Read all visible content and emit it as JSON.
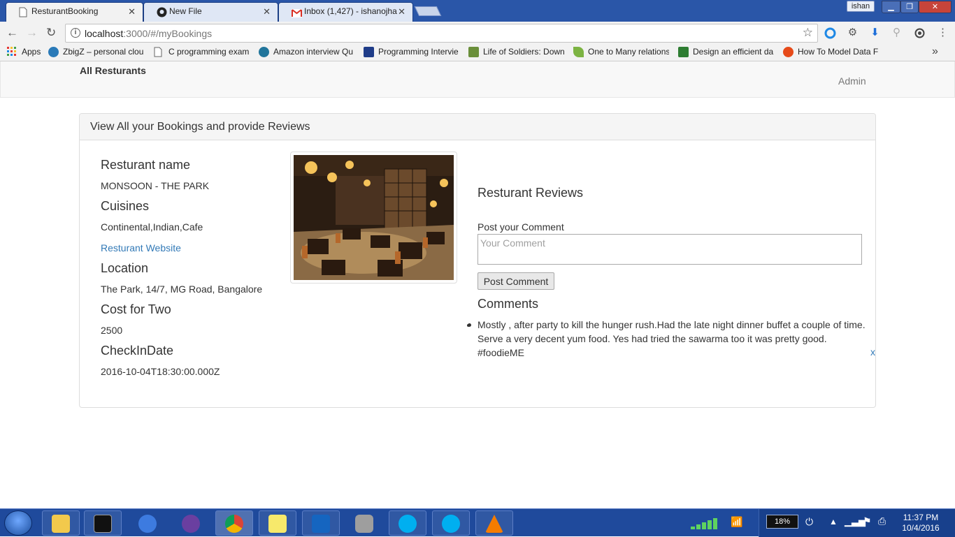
{
  "browser": {
    "tabs": [
      {
        "title": "ResturantBooking",
        "icon": "page-icon"
      },
      {
        "title": "New File",
        "icon": "github-icon"
      },
      {
        "title": "Inbox (1,427) - ishanojha",
        "icon": "gmail-icon"
      }
    ],
    "user": "ishan",
    "url_host": "localhost",
    "url_rest": ":3000/#/myBookings",
    "bookmarks": [
      {
        "label": "Apps",
        "icon": "apps-grid-icon",
        "color": "#e53935"
      },
      {
        "label": "ZbigZ – personal clou",
        "icon": "zbigz-icon",
        "color": "#2a7ab8"
      },
      {
        "label": "C programming exam",
        "icon": "page-icon",
        "color": "#ffffff"
      },
      {
        "label": "Amazon interview Qu",
        "icon": "wordpress-icon",
        "color": "#21759b"
      },
      {
        "label": "Programming Intervie",
        "icon": "grid-icon",
        "color": "#1f3c88"
      },
      {
        "label": "Life of Soldiers: Down",
        "icon": "picture-icon",
        "color": "#6a8f3a"
      },
      {
        "label": "One to Many relations",
        "icon": "leaf-icon",
        "color": "#7cb342"
      },
      {
        "label": "Design an efficient da",
        "icon": "geeks-icon",
        "color": "#2e7d32"
      },
      {
        "label": "How To Model Data F",
        "icon": "model-icon",
        "color": "#e64a19"
      }
    ]
  },
  "navbar": {
    "brand": "All Resturants",
    "admin": "Admin"
  },
  "panel": {
    "heading": "View All your Bookings and provide Reviews",
    "restaurant_name_label": "Resturant name",
    "restaurant_name": "MONSOON - THE PARK",
    "cuisines_label": "Cuisines",
    "cuisines": "Continental,Indian,Cafe",
    "website_link": "Resturant Website",
    "location_label": "Location",
    "location": "The Park, 14/7, MG Road, Bangalore",
    "cost_label": "Cost for Two",
    "cost": "2500",
    "checkin_label": "CheckInDate",
    "checkin": "2016-10-04T18:30:00.000Z",
    "reviews_title": "Resturant Reviews",
    "post_label": "Post your Comment",
    "comment_placeholder": "Your Comment",
    "post_button": "Post Comment",
    "comments_title": "Comments",
    "comments": [
      {
        "lines": [
          "Mostly , after party to kill the hunger rush.Had the late night dinner buffet a couple of time.",
          "Serve a very decent yum food. Yes had tried the sawarma too it was pretty good.",
          "#foodieME"
        ]
      }
    ],
    "delete_label": "x"
  },
  "taskbar": {
    "apps": [
      "file-explorer-icon",
      "cmd-icon",
      "thunderbird-icon",
      "nvu-icon",
      "chrome-icon",
      "sticky-notes-icon",
      "outlook-icon",
      "database-icon",
      "skype-icon",
      "skype-icon",
      "vlc-icon"
    ],
    "battery": "18%",
    "time": "11:37 PM",
    "date": "10/4/2016"
  }
}
